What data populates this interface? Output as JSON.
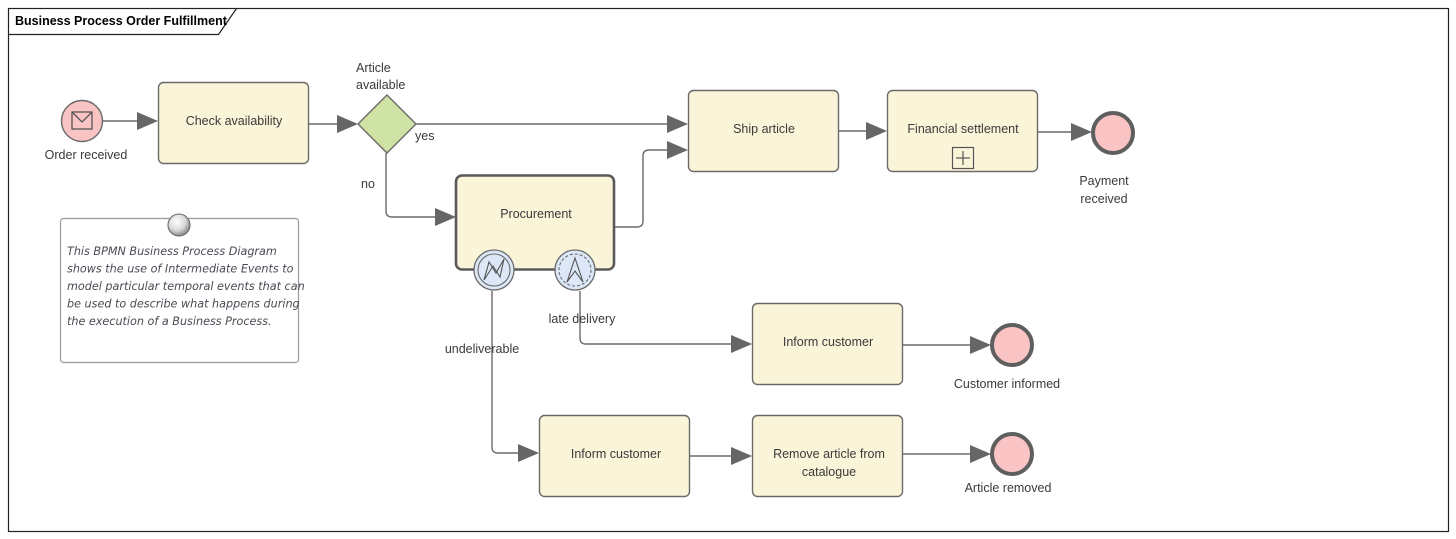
{
  "diagram": {
    "title": "Business Process Order Fulfillment",
    "colors": {
      "task_fill": "#faf5d9",
      "gateway_fill": "#cfe3a6",
      "event_fill": "#fbc4c4",
      "boundary_event_fill": "#dce8f8",
      "flow_line": "#6a6a6a"
    },
    "start_event": {
      "label": "Order received",
      "icon": "envelope-icon"
    },
    "tasks": {
      "check_availability": "Check availability",
      "ship_article": "Ship article",
      "financial_settlement": "Financial settlement",
      "procurement": "Procurement",
      "inform_customer_late": "Inform customer",
      "inform_customer_undeliverable": "Inform customer",
      "remove_article_line1": "Remove article from",
      "remove_article_line2": "catalogue"
    },
    "gateway": {
      "label_line1": "Article",
      "label_line2": "available",
      "yes": "yes",
      "no": "no"
    },
    "boundary_events": {
      "undeliverable": {
        "label": "undeliverable",
        "icon": "error-icon"
      },
      "late_delivery": {
        "label": "late delivery",
        "icon": "escalation-icon"
      }
    },
    "end_events": {
      "payment_received_line1": "Payment",
      "payment_received_line2": "received",
      "customer_informed": "Customer informed",
      "article_removed": "Article removed"
    },
    "note": {
      "lines": [
        "This BPMN Business Process Diagram",
        "shows the use of Intermediate Events to",
        "model particular temporal events that can",
        "be used to describe what happens during",
        "the execution of a Business Process."
      ]
    }
  }
}
